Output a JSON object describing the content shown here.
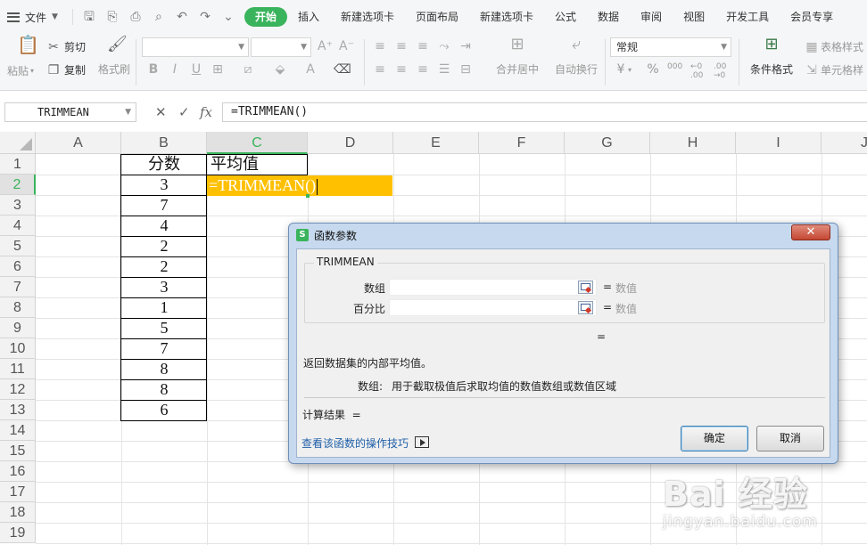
{
  "menubar": {
    "file_label": "文件",
    "tabs": [
      {
        "label": "开始",
        "active": true
      },
      {
        "label": "插入"
      },
      {
        "label": "新建选项卡"
      },
      {
        "label": "页面布局"
      },
      {
        "label": "新建选项卡"
      },
      {
        "label": "公式"
      },
      {
        "label": "数据"
      },
      {
        "label": "审阅"
      },
      {
        "label": "视图"
      },
      {
        "label": "开发工具"
      },
      {
        "label": "会员专享"
      }
    ],
    "accent_color": "#3ab45c"
  },
  "ribbon": {
    "paste": "粘贴",
    "cut": "剪切",
    "copy": "复制",
    "format_painter": "格式刷",
    "merge_center": "合并居中",
    "wrap_text": "自动换行",
    "number_format": "常规",
    "percent": "%",
    "thousands": "000",
    "conditional_format": "条件格式",
    "table_style": "表格样式",
    "cell_style": "单元格样"
  },
  "formula_bar": {
    "name_box": "TRIMMEAN",
    "fx": "fx",
    "formula": "=TRIMMEAN()"
  },
  "sheet": {
    "columns": [
      "A",
      "B",
      "C",
      "D",
      "E",
      "F",
      "G",
      "H",
      "I",
      "J"
    ],
    "rows": [
      "1",
      "2",
      "3",
      "4",
      "5",
      "6",
      "7",
      "8",
      "9",
      "10",
      "11",
      "12",
      "13",
      "14",
      "15",
      "16",
      "17",
      "18",
      "19"
    ],
    "selected_column": "C",
    "selected_row": "2",
    "b_header": "分数",
    "c_header": "平均值",
    "scores": [
      "3",
      "7",
      "4",
      "2",
      "2",
      "3",
      "1",
      "5",
      "7",
      "8",
      "8",
      "6"
    ],
    "active_cell_text": "=TRIMMEAN()",
    "active_fill": "#ffc000"
  },
  "dialog": {
    "logo": "S",
    "title": "函数参数",
    "close": "✕",
    "function_name": "TRIMMEAN",
    "args": [
      {
        "label": "数组",
        "eq": "=",
        "value": "数值"
      },
      {
        "label": "百分比",
        "eq": "=",
        "value": "数值"
      }
    ],
    "result_eq": "=",
    "description": "返回数据集的内部平均值。",
    "arg_help_label": "数组:",
    "arg_help_text": "用于截取极值后求取均值的数值数组或数值区域",
    "calc_result": "计算结果  =",
    "help_link": "查看该函数的操作技巧",
    "ok": "确定",
    "cancel": "取消"
  },
  "watermark": {
    "main": "Bai 经验",
    "sub": "jingyan.baidu.com"
  }
}
